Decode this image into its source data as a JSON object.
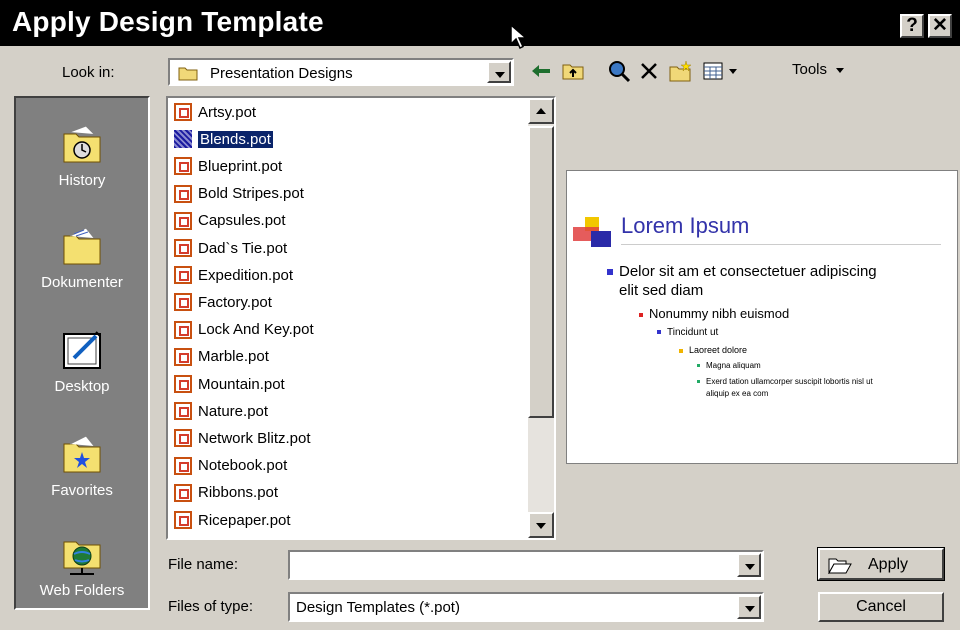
{
  "window": {
    "title": "Apply Design Template",
    "help_glyph": "?",
    "close_glyph": "✕"
  },
  "look_in": {
    "label": "Look in:",
    "value": "Presentation Designs"
  },
  "toolbar": {
    "tools_label": "Tools"
  },
  "places": [
    {
      "id": "history",
      "label": "History",
      "icon": "history-folder-icon"
    },
    {
      "id": "dokumenter",
      "label": "Dokumenter",
      "icon": "documents-folder-icon"
    },
    {
      "id": "desktop",
      "label": "Desktop",
      "icon": "desktop-icon"
    },
    {
      "id": "favorites",
      "label": "Favorites",
      "icon": "favorites-folder-icon"
    },
    {
      "id": "web-folders",
      "label": "Web Folders",
      "icon": "web-folders-icon"
    }
  ],
  "files": [
    {
      "name": "Artsy.pot",
      "selected": false
    },
    {
      "name": "Blends.pot",
      "selected": true
    },
    {
      "name": "Blueprint.pot",
      "selected": false
    },
    {
      "name": "Bold Stripes.pot",
      "selected": false
    },
    {
      "name": "Capsules.pot",
      "selected": false
    },
    {
      "name": "Dad`s Tie.pot",
      "selected": false
    },
    {
      "name": "Expedition.pot",
      "selected": false
    },
    {
      "name": "Factory.pot",
      "selected": false
    },
    {
      "name": "Lock And Key.pot",
      "selected": false
    },
    {
      "name": "Marble.pot",
      "selected": false
    },
    {
      "name": "Mountain.pot",
      "selected": false
    },
    {
      "name": "Nature.pot",
      "selected": false
    },
    {
      "name": "Network Blitz.pot",
      "selected": false
    },
    {
      "name": "Notebook.pot",
      "selected": false
    },
    {
      "name": "Ribbons.pot",
      "selected": false
    },
    {
      "name": "Ricepaper.pot",
      "selected": false
    }
  ],
  "preview": {
    "title": "Lorem Ipsum",
    "bullets": [
      {
        "level": 1,
        "text": "Delor sit am et consectetuer adipiscing",
        "color": "#3333cc"
      },
      {
        "level": 1,
        "text": "elit sed diam",
        "color": "",
        "continuation": true
      },
      {
        "level": 2,
        "text": "Nonummy nibh euismod",
        "color": "#dd2222"
      },
      {
        "level": 3,
        "text": "Tincidunt ut",
        "color": "#3333cc"
      },
      {
        "level": 4,
        "text": "Laoreet dolore",
        "color": "#f0b400"
      },
      {
        "level": 5,
        "text": "Magna aliquam",
        "color": "#22aa66"
      },
      {
        "level": 5,
        "text": "Exerd tation ullamcorper suscipit lobortis nisl ut",
        "color": "#22aa66"
      },
      {
        "level": 5,
        "text": "aliquip ex ea com",
        "color": "",
        "continuation": true
      }
    ]
  },
  "file_name": {
    "label": "File name:",
    "value": ""
  },
  "files_of_type": {
    "label": "Files of type:",
    "value": "Design Templates (*.pot)"
  },
  "buttons": {
    "apply": "Apply",
    "cancel": "Cancel"
  },
  "colors": {
    "title_bar": "#000000",
    "dialog_face": "#d4d0c8",
    "selection": "#0a246a",
    "places_bar": "#808080"
  }
}
